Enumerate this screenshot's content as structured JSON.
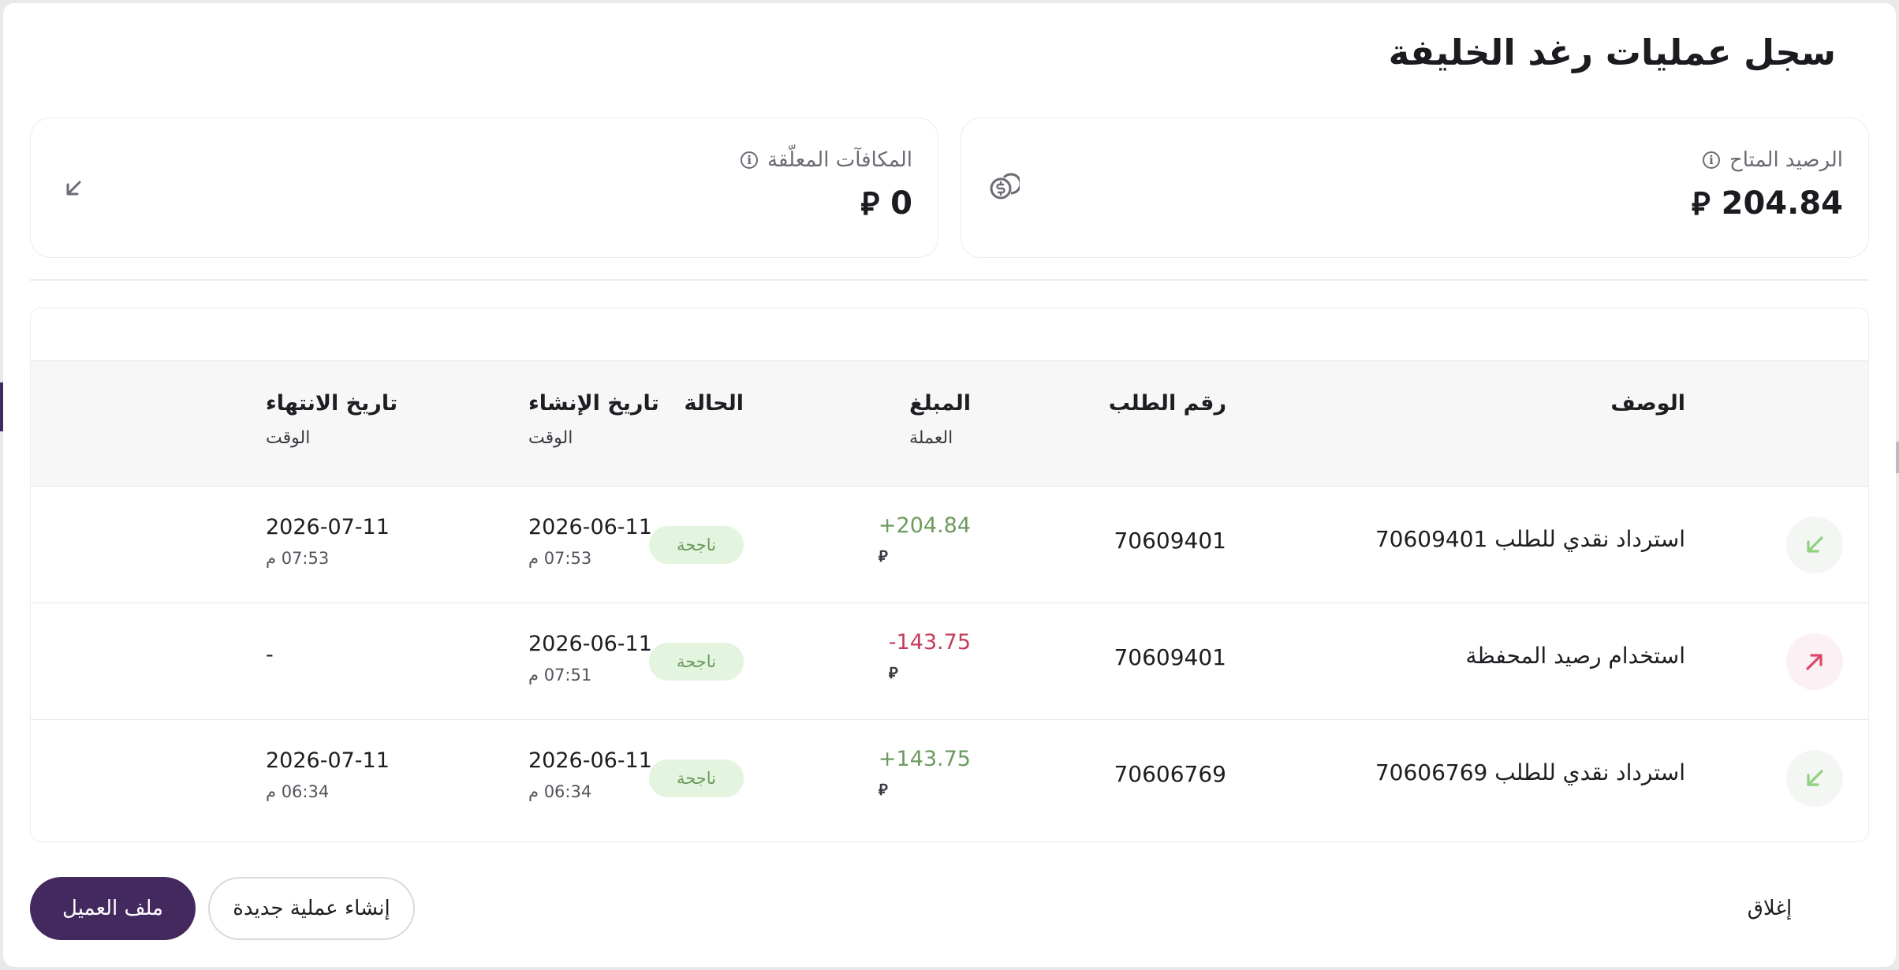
{
  "modal": {
    "title": "سجل عمليات رغد الخليفة"
  },
  "summary": {
    "balance": {
      "label": "الرصيد المتاح",
      "value": "204.84",
      "currency_symbol": "⃁",
      "icon": "coins-icon"
    },
    "rewards": {
      "label": "المكافآت المعلّقة",
      "value": "0",
      "currency_symbol": "⃁",
      "icon": "arrow-down-left-icon"
    },
    "info_glyph": "i"
  },
  "table": {
    "headers": {
      "description": "الوصف",
      "order_no": "رقم الطلب",
      "amount": "المبلغ",
      "amount_sub": "العملة",
      "status": "الحالة",
      "created": "تاريخ الإنشاء",
      "created_sub": "الوقت",
      "ended": "تاريخ الانتهاء",
      "ended_sub": "الوقت"
    },
    "rows": [
      {
        "direction": "in",
        "description": "استرداد نقدي للطلب 70609401",
        "order_no": "70609401",
        "amount": "+204.84",
        "currency": "⃁",
        "status": "ناجحة",
        "created_date": "2026-06-11",
        "created_time": "07:53 م",
        "ended_date": "2026-07-11",
        "ended_time": "07:53 م"
      },
      {
        "direction": "out",
        "description": "استخدام رصيد المحفظة",
        "order_no": "70609401",
        "amount": "-143.75",
        "currency": "⃁",
        "status": "ناجحة",
        "created_date": "2026-06-11",
        "created_time": "07:51 م",
        "ended_date": "-",
        "ended_time": ""
      },
      {
        "direction": "in",
        "description": "استرداد نقدي للطلب 70606769",
        "order_no": "70606769",
        "amount": "+143.75",
        "currency": "⃁",
        "status": "ناجحة",
        "created_date": "2026-06-11",
        "created_time": "06:34 م",
        "ended_date": "2026-07-11",
        "ended_time": "06:34 م"
      }
    ]
  },
  "footer": {
    "customer_profile": "ملف العميل",
    "new_transaction": "إنشاء عملية جديدة",
    "close": "إغلاق"
  },
  "colors": {
    "primary": "#44295f",
    "positive": "#6d9a5f",
    "negative": "#c43c5c",
    "status_bg": "#e3f4df"
  }
}
